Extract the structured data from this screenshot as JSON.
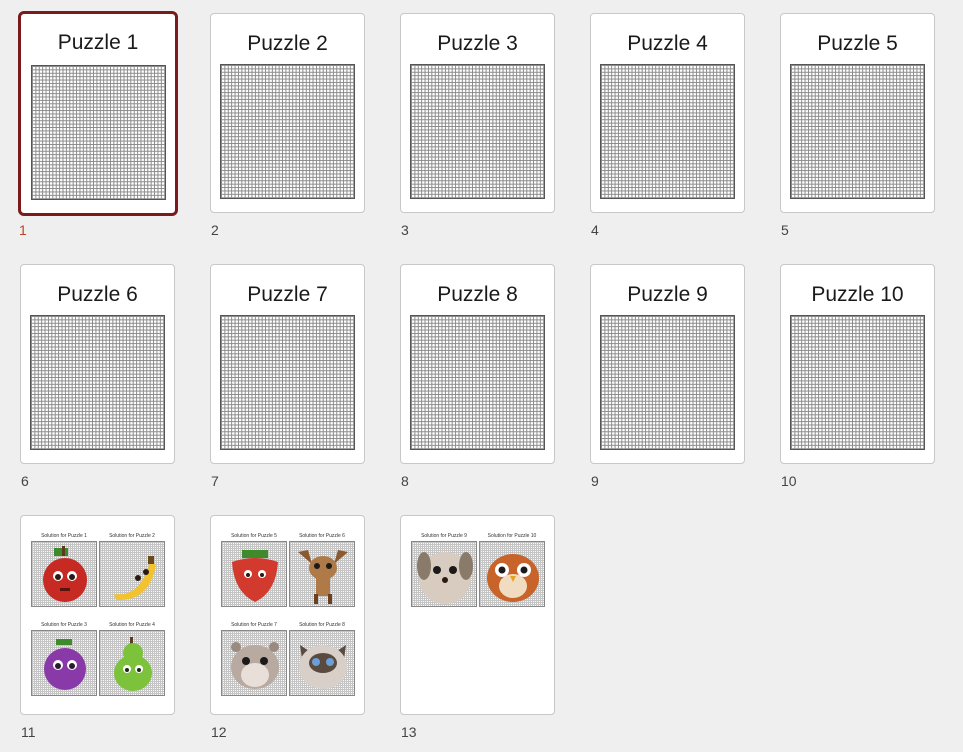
{
  "slides": [
    {
      "number": "1",
      "title": "Puzzle 1"
    },
    {
      "number": "2",
      "title": "Puzzle 2"
    },
    {
      "number": "3",
      "title": "Puzzle 3"
    },
    {
      "number": "4",
      "title": "Puzzle 4"
    },
    {
      "number": "5",
      "title": "Puzzle 5"
    },
    {
      "number": "6",
      "title": "Puzzle 6"
    },
    {
      "number": "7",
      "title": "Puzzle 7"
    },
    {
      "number": "8",
      "title": "Puzzle 8"
    },
    {
      "number": "9",
      "title": "Puzzle 9"
    },
    {
      "number": "10",
      "title": "Puzzle 10"
    },
    {
      "number": "11",
      "solutions": [
        "Solution for Puzzle 1",
        "Solution for Puzzle 2",
        "Solution for Puzzle 3",
        "Solution for Puzzle 4"
      ]
    },
    {
      "number": "12",
      "solutions": [
        "Solution for Puzzle 5",
        "Solution for Puzzle 6",
        "Solution for Puzzle 7",
        "Solution for Puzzle 8"
      ]
    },
    {
      "number": "13",
      "solutions": [
        "Solution for Puzzle 9",
        "Solution for Puzzle 10"
      ]
    }
  ],
  "selected_slide": "1",
  "colors": {
    "selection_border": "#7b1a1a",
    "selected_number": "#b5442a"
  }
}
